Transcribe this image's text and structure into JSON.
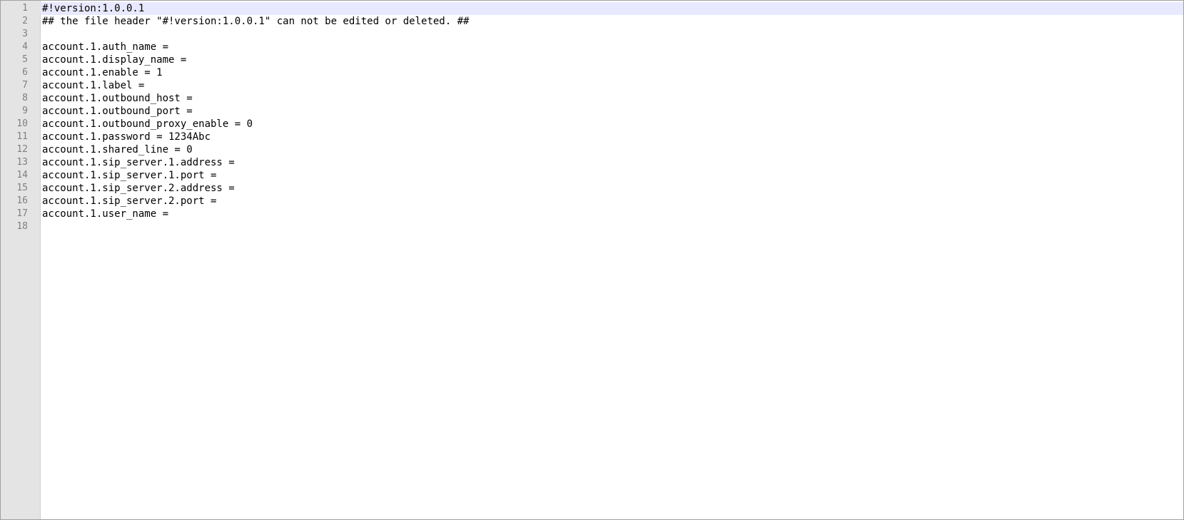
{
  "editor": {
    "current_line": 1,
    "lines": [
      {
        "num": "1",
        "text": "#!version:1.0.0.1"
      },
      {
        "num": "2",
        "text": "## the file header \"#!version:1.0.0.1\" can not be edited or deleted. ##"
      },
      {
        "num": "3",
        "text": ""
      },
      {
        "num": "4",
        "text": "account.1.auth_name ="
      },
      {
        "num": "5",
        "text": "account.1.display_name ="
      },
      {
        "num": "6",
        "text": "account.1.enable = 1"
      },
      {
        "num": "7",
        "text": "account.1.label ="
      },
      {
        "num": "8",
        "text": "account.1.outbound_host ="
      },
      {
        "num": "9",
        "text": "account.1.outbound_port ="
      },
      {
        "num": "10",
        "text": "account.1.outbound_proxy_enable = 0"
      },
      {
        "num": "11",
        "text": "account.1.password = 1234Abc"
      },
      {
        "num": "12",
        "text": "account.1.shared_line = 0"
      },
      {
        "num": "13",
        "text": "account.1.sip_server.1.address ="
      },
      {
        "num": "14",
        "text": "account.1.sip_server.1.port ="
      },
      {
        "num": "15",
        "text": "account.1.sip_server.2.address ="
      },
      {
        "num": "16",
        "text": "account.1.sip_server.2.port ="
      },
      {
        "num": "17",
        "text": "account.1.user_name ="
      },
      {
        "num": "18",
        "text": ""
      }
    ]
  }
}
